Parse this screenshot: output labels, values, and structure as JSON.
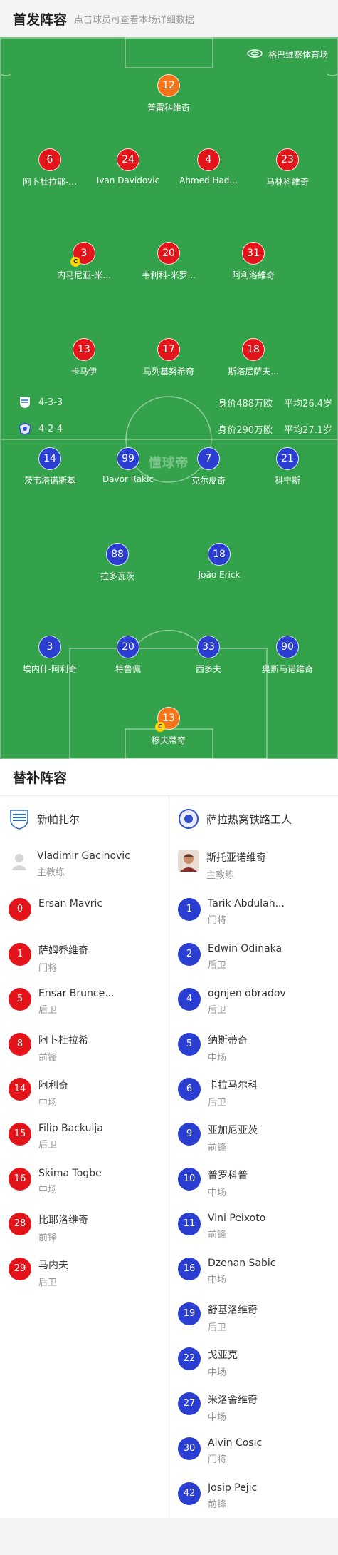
{
  "header": {
    "title": "首发阵容",
    "subtitle": "点击球员可查看本场详细数据"
  },
  "pitch": {
    "stadium": "格巴维察体育场",
    "watermark": "懂球帝",
    "home_info": {
      "formation": "4-3-3",
      "value": "身价488万欧",
      "age": "平均26.4岁"
    },
    "away_info": {
      "formation": "4-2-4",
      "value": "身价290万欧",
      "age": "平均27.1岁"
    },
    "home_players": [
      {
        "num": "12",
        "name": "普雷科維奇",
        "color": "orange"
      },
      {
        "num": "6",
        "name": "阿卜杜拉耶-...",
        "color": "red"
      },
      {
        "num": "24",
        "name": "Ivan Davidovic",
        "color": "red"
      },
      {
        "num": "4",
        "name": "Ahmed Had...",
        "color": "red"
      },
      {
        "num": "23",
        "name": "马林科維奇",
        "color": "red"
      },
      {
        "num": "3",
        "name": "内马尼亚-米...",
        "color": "red",
        "captain": "C"
      },
      {
        "num": "20",
        "name": "韦利科-米罗...",
        "color": "red"
      },
      {
        "num": "31",
        "name": "阿利洛維奇",
        "color": "red"
      },
      {
        "num": "13",
        "name": "卡马伊",
        "color": "red"
      },
      {
        "num": "17",
        "name": "马列基努希奇",
        "color": "red"
      },
      {
        "num": "18",
        "name": "斯塔尼萨夫...",
        "color": "red"
      }
    ],
    "away_players": [
      {
        "num": "14",
        "name": "茨韦塔诺斯基",
        "color": "blue"
      },
      {
        "num": "99",
        "name": "Davor Rakic",
        "color": "blue"
      },
      {
        "num": "7",
        "name": "克尔皮奇",
        "color": "blue"
      },
      {
        "num": "21",
        "name": "科宁斯",
        "color": "blue"
      },
      {
        "num": "88",
        "name": "拉多瓦茨",
        "color": "blue"
      },
      {
        "num": "18",
        "name": "João Erick",
        "color": "blue"
      },
      {
        "num": "3",
        "name": "埃内什-阿利奇",
        "color": "blue"
      },
      {
        "num": "20",
        "name": "特鲁佩",
        "color": "blue"
      },
      {
        "num": "33",
        "name": "西多夫",
        "color": "blue"
      },
      {
        "num": "90",
        "name": "奥斯马诺维奇",
        "color": "blue"
      },
      {
        "num": "13",
        "name": "穆夫蒂奇",
        "color": "orange",
        "captain": "C"
      }
    ]
  },
  "subs": {
    "title": "替补阵容",
    "home": {
      "team": "新帕扎尔",
      "coach_name": "Vladimir Gacinovic",
      "coach_role": "主教练",
      "players": [
        {
          "num": "0",
          "name": "Ersan Mavric",
          "pos": ""
        },
        {
          "num": "1",
          "name": "萨姆乔维奇",
          "pos": "门将"
        },
        {
          "num": "5",
          "name": "Ensar Brunce...",
          "pos": "后卫"
        },
        {
          "num": "8",
          "name": "阿卜杜拉希",
          "pos": "前锋"
        },
        {
          "num": "14",
          "name": "阿利奇",
          "pos": "中场"
        },
        {
          "num": "15",
          "name": "Filip Backulja",
          "pos": "后卫"
        },
        {
          "num": "16",
          "name": "Skima Togbe",
          "pos": "中场"
        },
        {
          "num": "28",
          "name": "比耶洛维奇",
          "pos": "前锋"
        },
        {
          "num": "29",
          "name": "马内夫",
          "pos": "后卫"
        }
      ]
    },
    "away": {
      "team": "萨拉热窝铁路工人",
      "coach_name": "斯托亚诺维奇",
      "coach_role": "主教练",
      "players": [
        {
          "num": "1",
          "name": "Tarik Abdulah...",
          "pos": "门将"
        },
        {
          "num": "2",
          "name": "Edwin Odinaka",
          "pos": "后卫"
        },
        {
          "num": "4",
          "name": "ognjen obradov",
          "pos": "后卫"
        },
        {
          "num": "5",
          "name": "纳斯蒂奇",
          "pos": "中场"
        },
        {
          "num": "6",
          "name": "卡拉马尔科",
          "pos": "后卫"
        },
        {
          "num": "9",
          "name": "亚加尼亚茨",
          "pos": "前锋"
        },
        {
          "num": "10",
          "name": "普罗科普",
          "pos": "中场"
        },
        {
          "num": "11",
          "name": "Vini Peixoto",
          "pos": "前锋"
        },
        {
          "num": "16",
          "name": "Dzenan Sabic",
          "pos": "中场"
        },
        {
          "num": "19",
          "name": "舒基洛维奇",
          "pos": "后卫"
        },
        {
          "num": "22",
          "name": "戈亚克",
          "pos": "中场"
        },
        {
          "num": "27",
          "name": "米洛舍维奇",
          "pos": "中场"
        },
        {
          "num": "30",
          "name": "Alvin Cosic",
          "pos": "门将"
        },
        {
          "num": "42",
          "name": "Josip Pejic",
          "pos": "前锋"
        }
      ]
    }
  },
  "colors": {
    "pitch": "#33a24a",
    "home": "#e4141b",
    "away": "#2a3fd1",
    "gk": "#f6741a"
  }
}
